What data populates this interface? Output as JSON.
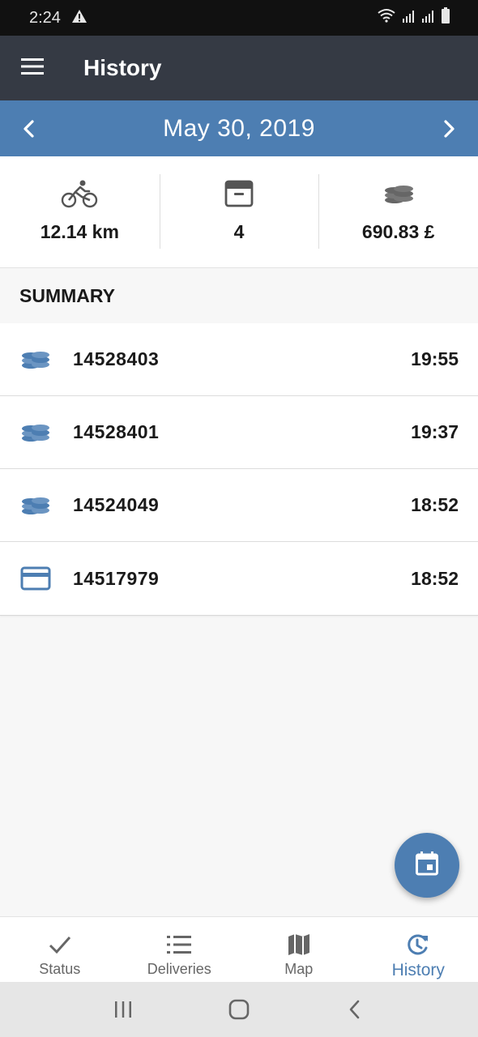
{
  "status_bar": {
    "time": "2:24"
  },
  "appbar": {
    "title": "History"
  },
  "datebar": {
    "date": "May 30, 2019"
  },
  "stats": {
    "distance": "12.14 km",
    "deliveries": "4",
    "amount": "690.83 £"
  },
  "summary": {
    "header": "SUMMARY",
    "rows": [
      {
        "icon": "coins-icon",
        "id": "14528403",
        "time": "19:55"
      },
      {
        "icon": "coins-icon",
        "id": "14528401",
        "time": "19:37"
      },
      {
        "icon": "coins-icon",
        "id": "14524049",
        "time": "18:52"
      },
      {
        "icon": "card-icon",
        "id": "14517979",
        "time": "18:52"
      }
    ]
  },
  "bottom_nav": {
    "items": [
      {
        "label": "Status",
        "icon": "check-icon"
      },
      {
        "label": "Deliveries",
        "icon": "list-icon"
      },
      {
        "label": "Map",
        "icon": "map-icon"
      },
      {
        "label": "History",
        "icon": "history-icon"
      }
    ],
    "active": "History"
  },
  "colors": {
    "accent": "#4d7eb2",
    "appbar": "#353a44",
    "statusbar": "#111111"
  }
}
